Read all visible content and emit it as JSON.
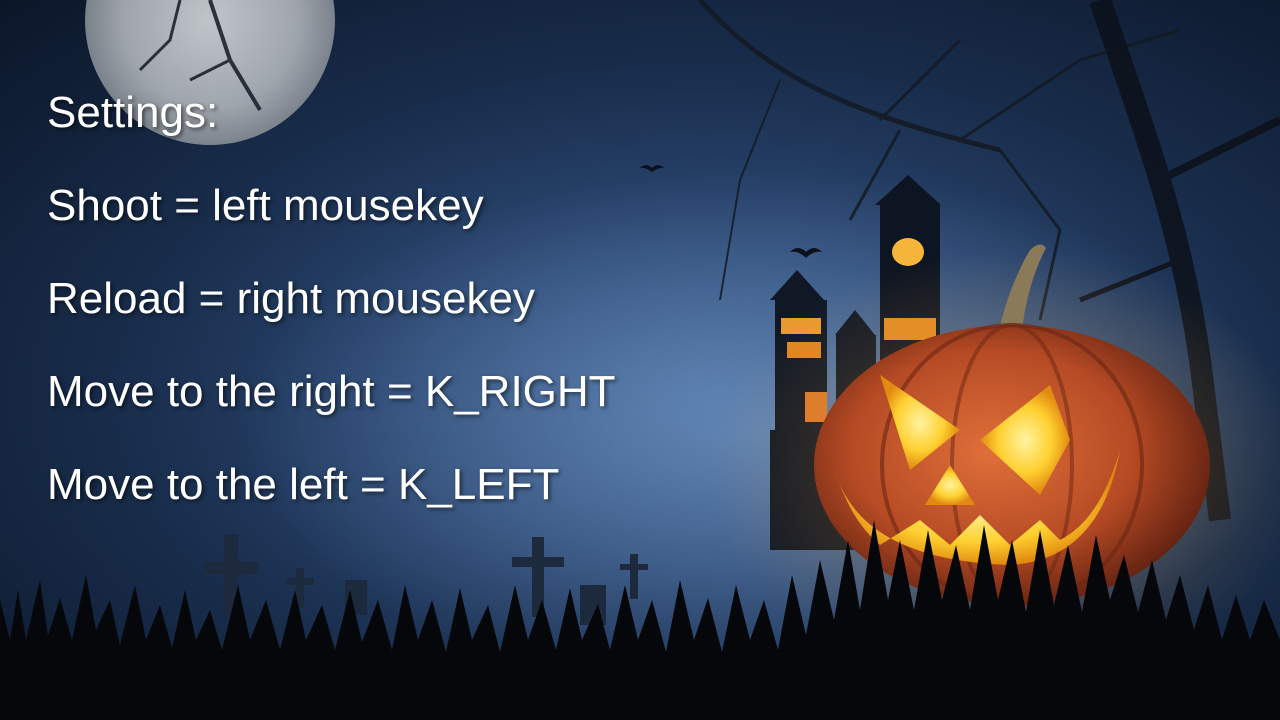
{
  "settings": {
    "heading": "Settings:",
    "lines": [
      "Shoot = left mousekey",
      "Reload = right mousekey",
      "Move to the right = K_RIGHT",
      "Move to the left = K_LEFT"
    ]
  },
  "background": {
    "icons": [
      "moon-icon",
      "haunted-castle-icon",
      "pumpkin-icon",
      "grave-cross-icon",
      "bat-icon"
    ],
    "colors": {
      "sky": "#2a4670",
      "moon": "#c9cdd1",
      "pumpkin": "#c4542a",
      "glow": "#ffd24a",
      "grass": "#05070b"
    }
  }
}
